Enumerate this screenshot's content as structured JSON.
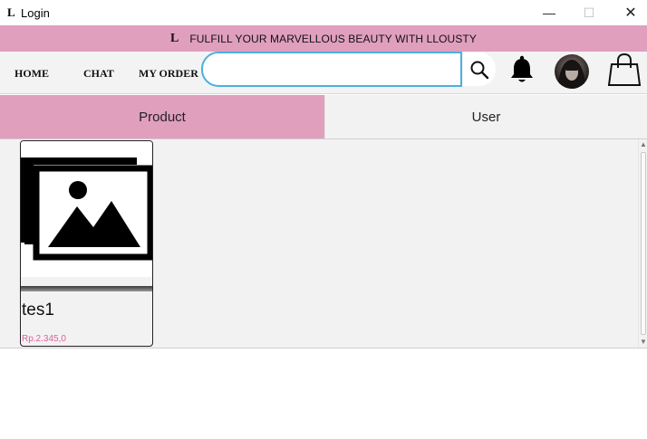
{
  "window": {
    "app_icon": "L",
    "title": "Login",
    "minimize": "—",
    "maximize": "☐",
    "close": "✕"
  },
  "banner": {
    "logo": "L",
    "text": "FULFILL YOUR MARVELLOUS BEAUTY WITH LLOUSTY",
    "color": "#e09fbd"
  },
  "nav": {
    "home": "HOME",
    "chat": "CHAT",
    "my_order": "MY ORDER",
    "search_value": "",
    "search_placeholder": "",
    "icons": [
      "search-icon",
      "bell-icon",
      "avatar",
      "shopping-bag-icon"
    ]
  },
  "tabs": [
    {
      "label": "Product",
      "selected": true
    },
    {
      "label": "User",
      "selected": false
    }
  ],
  "products": [
    {
      "name": "tes1",
      "price": "Rp.2.345,0",
      "image": "image-placeholder-icon"
    }
  ],
  "colors": {
    "accent": "#e09fbd",
    "price": "#e0609a",
    "search_border": "#4cb0e0"
  }
}
